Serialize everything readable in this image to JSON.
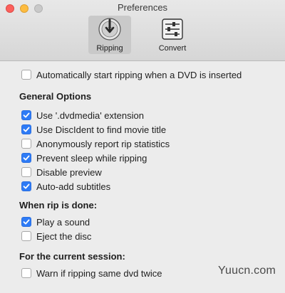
{
  "window": {
    "title": "Preferences"
  },
  "toolbar": {
    "items": [
      {
        "label": "Ripping",
        "active": true,
        "icon": "ripping-icon"
      },
      {
        "label": "Convert",
        "active": false,
        "icon": "convert-sliders-icon"
      }
    ]
  },
  "options": {
    "auto_start": {
      "label": "Automatically start ripping when a DVD is inserted",
      "checked": false
    }
  },
  "general": {
    "heading": "General Options",
    "items": [
      {
        "label": "Use '.dvdmedia' extension",
        "checked": true
      },
      {
        "label": "Use DiscIdent to find movie title",
        "checked": true
      },
      {
        "label": "Anonymously report rip statistics",
        "checked": false
      },
      {
        "label": "Prevent sleep while ripping",
        "checked": true
      },
      {
        "label": "Disable preview",
        "checked": false
      },
      {
        "label": "Auto-add subtitles",
        "checked": true
      }
    ]
  },
  "when_done": {
    "heading": "When rip is done:",
    "items": [
      {
        "label": "Play a sound",
        "checked": true
      },
      {
        "label": "Eject the disc",
        "checked": false
      }
    ]
  },
  "session": {
    "heading": "For the current session:",
    "items": [
      {
        "label": "Warn if ripping same dvd twice",
        "checked": false
      }
    ]
  },
  "watermark": "Yuucn.com",
  "colors": {
    "accent": "#2e7bf6",
    "window_bg": "#ececec"
  }
}
